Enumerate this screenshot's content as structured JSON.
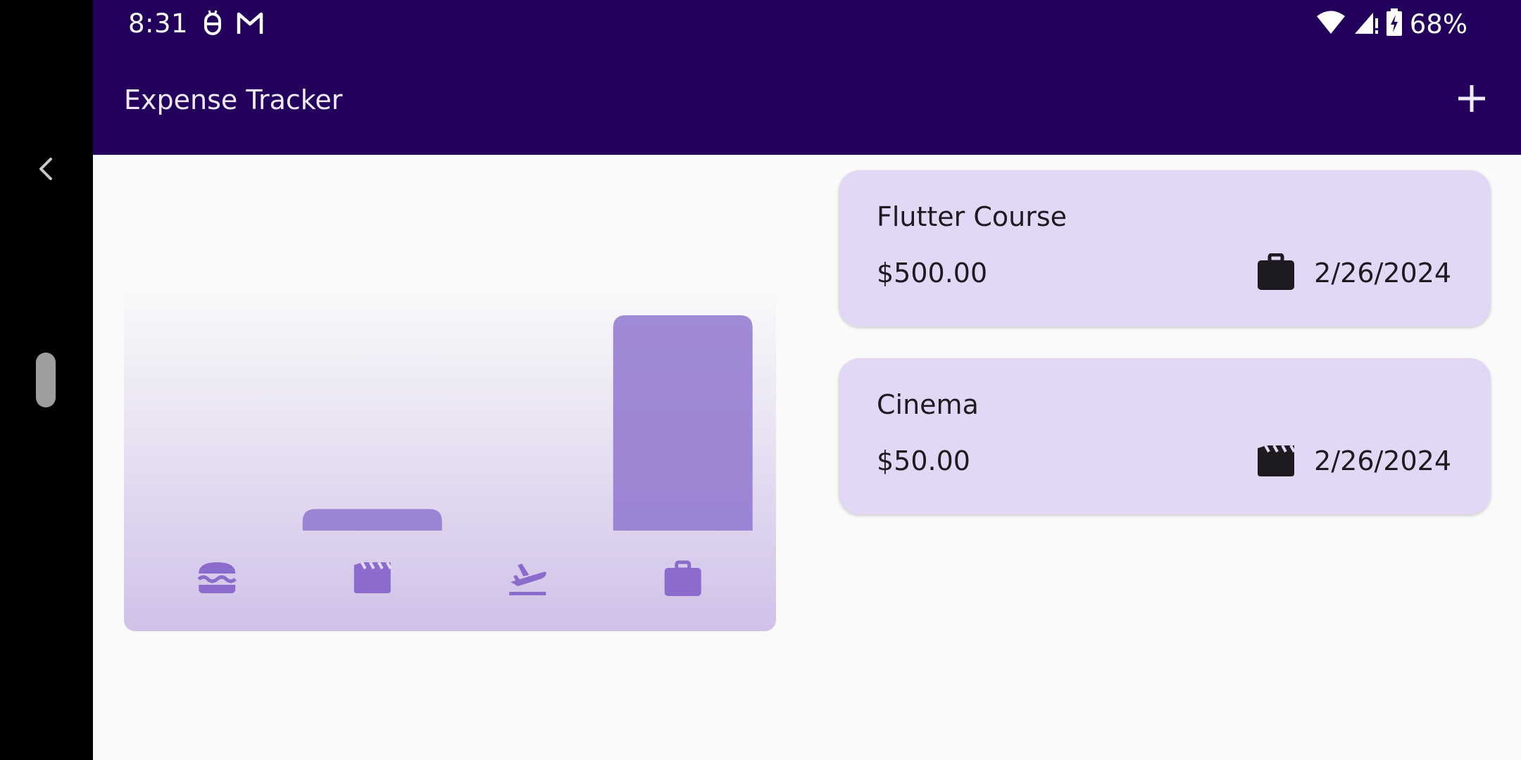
{
  "status_bar": {
    "time": "8:31",
    "battery": "68%",
    "left_icons": [
      "bug-report-icon",
      "gmail-icon"
    ],
    "right_icons": [
      "wifi-icon",
      "cell-signal-icon",
      "battery-charging-icon"
    ]
  },
  "app_bar": {
    "title": "Expense Tracker",
    "add_icon": "plus-icon"
  },
  "colors": {
    "app_bar": "#22005c",
    "card": "#e2d7f5",
    "bar": "#9175cf",
    "icon": "#8b6ccd",
    "background": "#fafafa"
  },
  "chart_data": {
    "type": "bar",
    "categories": [
      "food",
      "leisure",
      "travel",
      "work"
    ],
    "category_icons": [
      "burger-icon",
      "movie-clapper-icon",
      "flight-takeoff-icon",
      "briefcase-icon"
    ],
    "values": [
      0,
      50,
      0,
      500
    ],
    "ylim": [
      0,
      500
    ]
  },
  "expenses": [
    {
      "title": "Flutter Course",
      "amount": "$500.00",
      "date": "2/26/2024",
      "category_icon": "briefcase-icon"
    },
    {
      "title": "Cinema",
      "amount": "$50.00",
      "date": "2/26/2024",
      "category_icon": "movie-clapper-icon"
    }
  ]
}
